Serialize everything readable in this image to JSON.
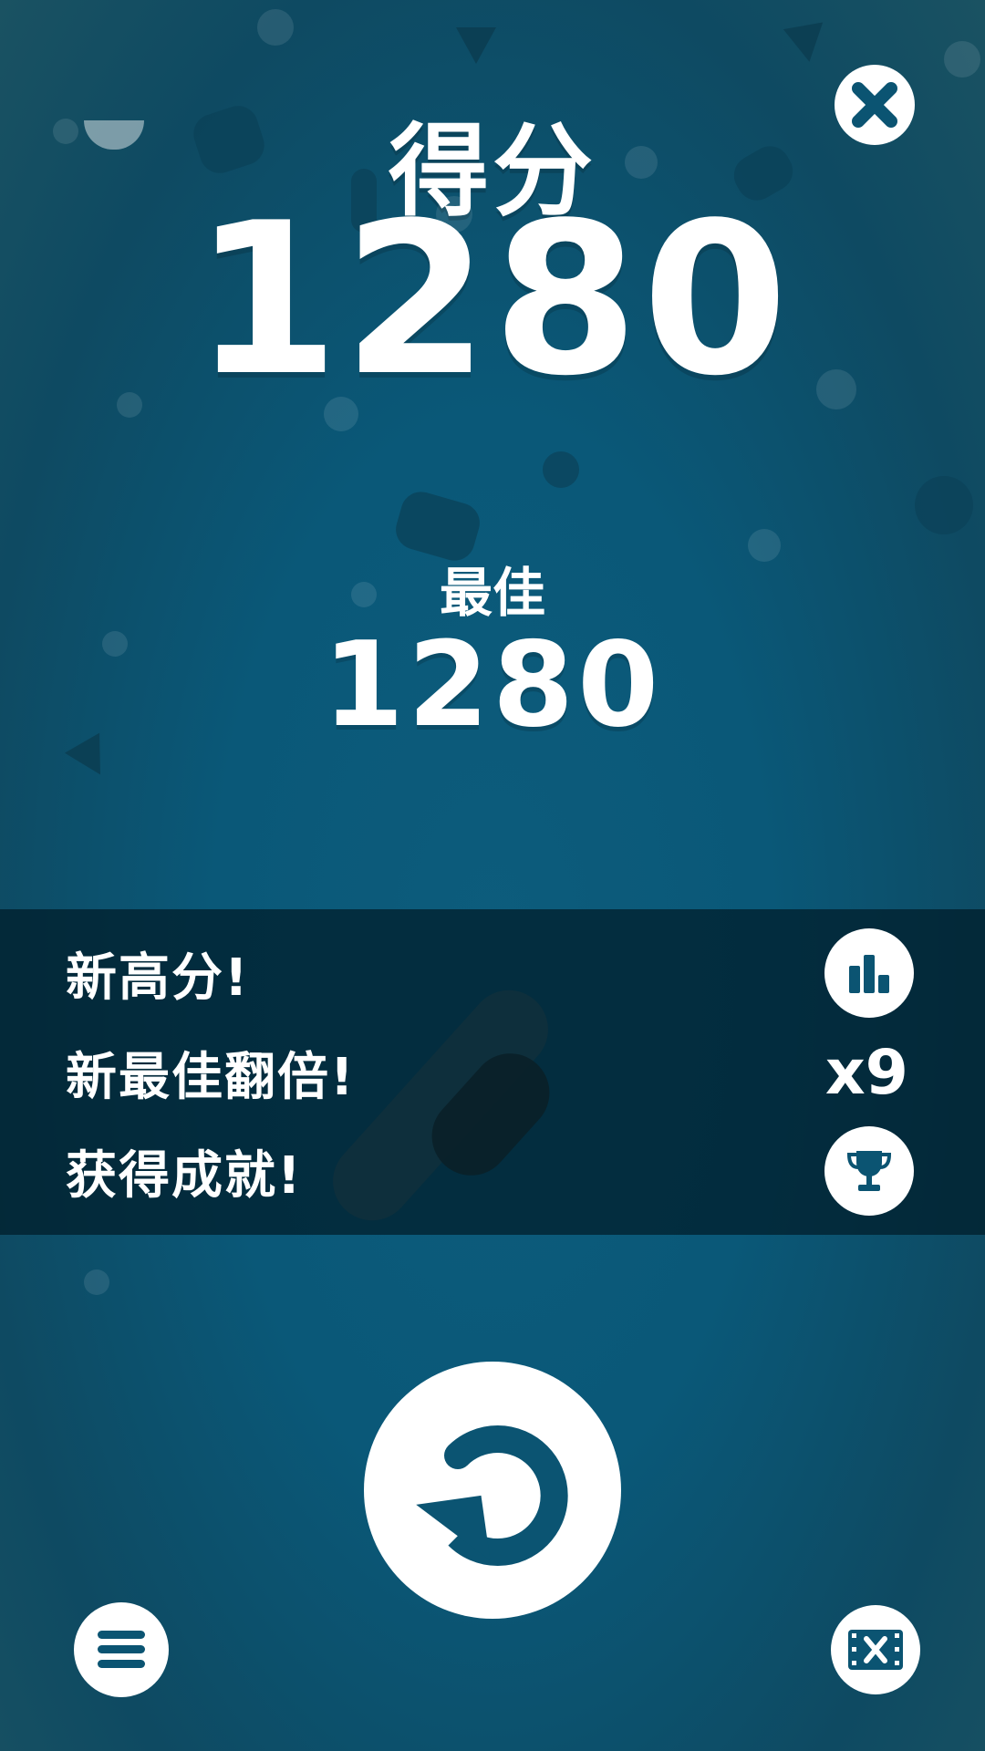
{
  "header": {
    "score_label": "得分",
    "score_value": "1280",
    "best_label": "最佳",
    "best_value": "1280"
  },
  "results": [
    {
      "text": "新高分!",
      "icon": "leaderboard-icon"
    },
    {
      "text": "新最佳翻倍!",
      "multiplier": "x9"
    },
    {
      "text": "获得成就!",
      "icon": "trophy-icon"
    }
  ],
  "controls": {
    "close_icon": "close-icon",
    "replay_icon": "replay-icon",
    "menu_icon": "menu-icon",
    "no_ads_icon": "no-ads-icon"
  },
  "colors": {
    "background": "#0a5878",
    "band": "#002838",
    "icon_fill": "#0b5472",
    "button": "#ffffff"
  }
}
